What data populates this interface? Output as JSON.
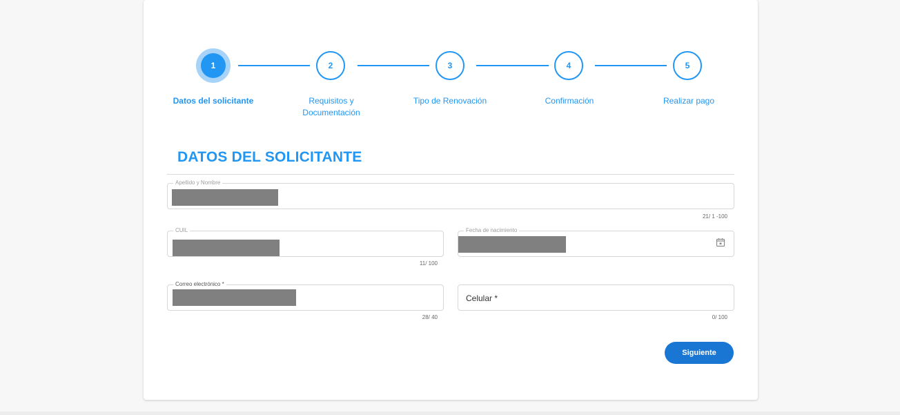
{
  "stepper": {
    "steps": [
      {
        "number": "1",
        "label": "Datos del solicitante",
        "active": true
      },
      {
        "number": "2",
        "label": "Requisitos y Documentación",
        "active": false
      },
      {
        "number": "3",
        "label": "Tipo de Renovación",
        "active": false
      },
      {
        "number": "4",
        "label": "Confirmación",
        "active": false
      },
      {
        "number": "5",
        "label": "Realizar pago",
        "active": false
      }
    ]
  },
  "form": {
    "title": "DATOS DEL SOLICITANTE",
    "fields": {
      "nombre": {
        "label": "Apellido y Nombre",
        "counter": "21/ 1 -100"
      },
      "cuil": {
        "label": "CUIL",
        "counter": "11/ 100"
      },
      "fecha": {
        "label": "Fecha de nacimiento",
        "icon": "calendar-icon"
      },
      "correo": {
        "label": "Correo electrónico *",
        "counter": "28/ 40"
      },
      "celular": {
        "placeholder": "Celular *",
        "counter": "0/ 100"
      }
    },
    "next_label": "Siguiente"
  },
  "colors": {
    "accent": "#2196f3",
    "button": "#1976d2",
    "active_halo": "#a7d3f8",
    "redaction": "#808080"
  }
}
